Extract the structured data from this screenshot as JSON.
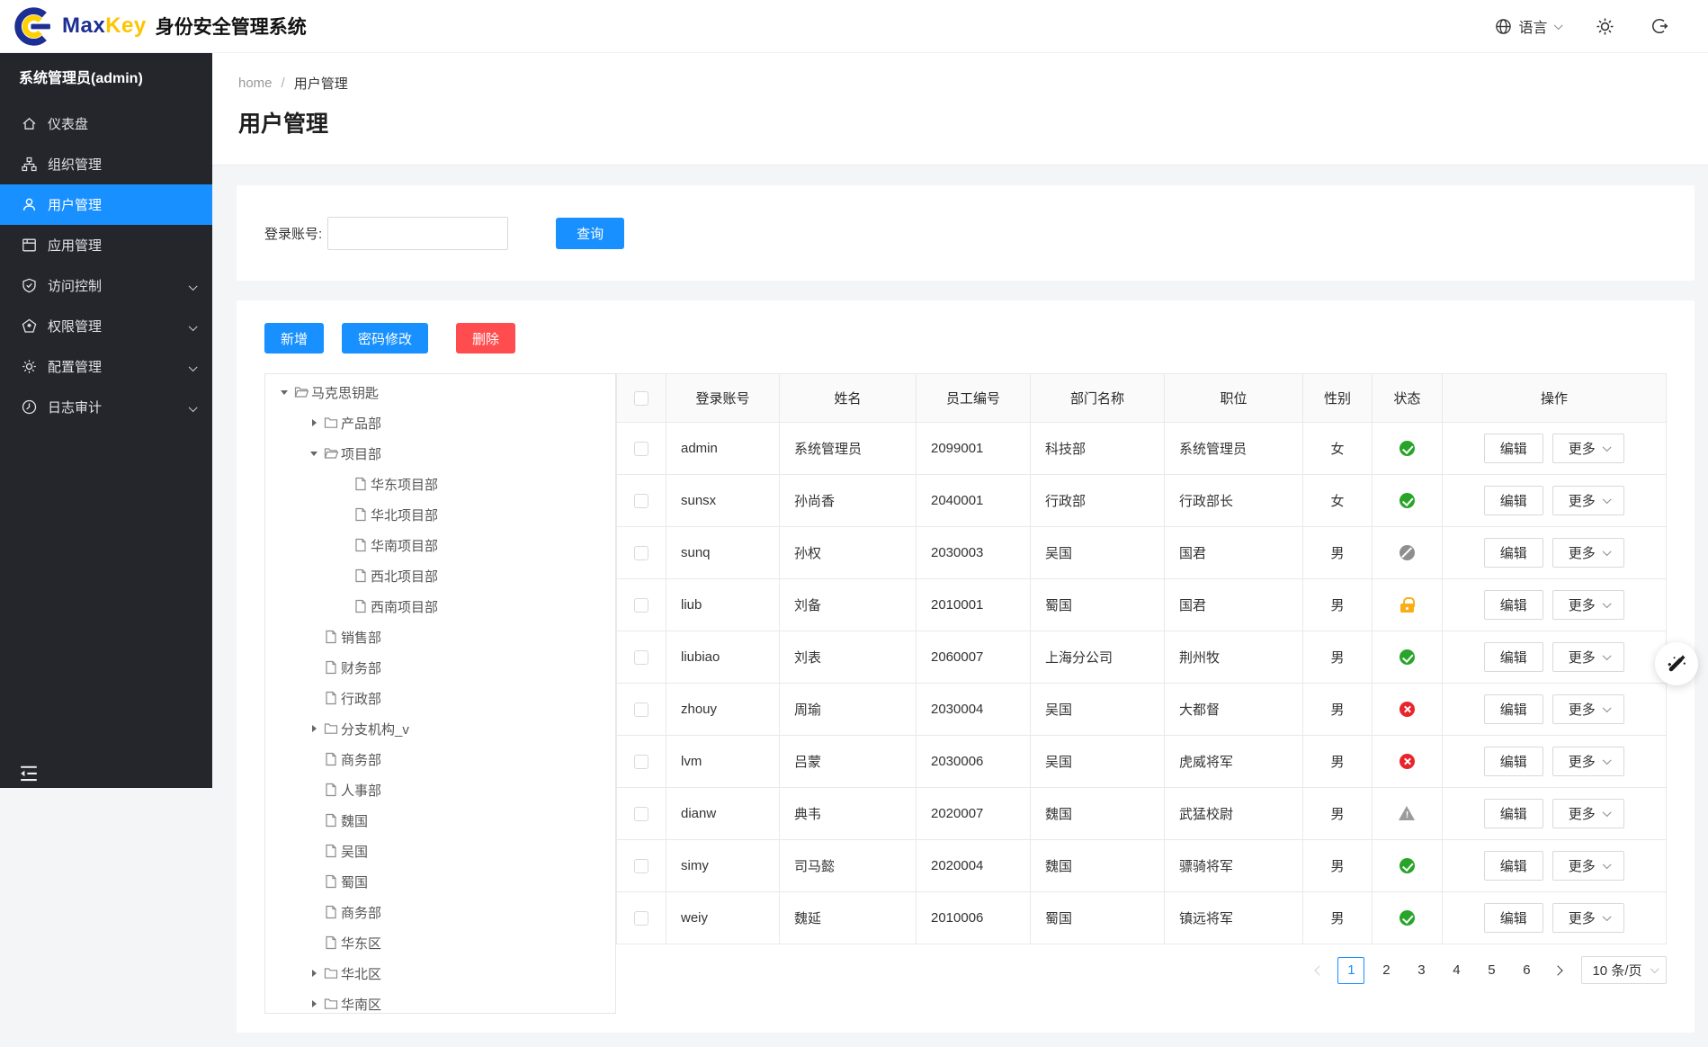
{
  "brand": {
    "max": "Max",
    "key": "Key",
    "app_title": "身份安全管理系统"
  },
  "topbar": {
    "language": "语言"
  },
  "sidebar": {
    "user_title": "系统管理员(admin)",
    "items": [
      {
        "id": "dashboard",
        "icon": "home",
        "label": "仪表盘",
        "active": false,
        "expandable": false
      },
      {
        "id": "org",
        "icon": "cluster",
        "label": "组织管理",
        "active": false,
        "expandable": false
      },
      {
        "id": "users",
        "icon": "user",
        "label": "用户管理",
        "active": true,
        "expandable": false
      },
      {
        "id": "apps",
        "icon": "appstore",
        "label": "应用管理",
        "active": false,
        "expandable": false
      },
      {
        "id": "access",
        "icon": "shield",
        "label": "访问控制",
        "active": false,
        "expandable": true
      },
      {
        "id": "permissions",
        "icon": "pentagon",
        "label": "权限管理",
        "active": false,
        "expandable": true
      },
      {
        "id": "config",
        "icon": "gear",
        "label": "配置管理",
        "active": false,
        "expandable": true
      },
      {
        "id": "audit",
        "icon": "clock",
        "label": "日志审计",
        "active": false,
        "expandable": true
      }
    ]
  },
  "breadcrumb": {
    "home": "home",
    "separator": "/",
    "current": "用户管理"
  },
  "page": {
    "title": "用户管理"
  },
  "search": {
    "label": "登录账号:",
    "input_value": "",
    "query": "查询"
  },
  "toolbar": {
    "add": "新增",
    "change_password": "密码修改",
    "remove": "删除"
  },
  "tree": {
    "nodes": [
      {
        "level": 0,
        "caret": "down",
        "icon": "folder-open",
        "label": "马克思钥匙"
      },
      {
        "level": 1,
        "caret": "right",
        "icon": "folder",
        "label": "产品部"
      },
      {
        "level": 1,
        "caret": "down",
        "icon": "folder-open",
        "label": "项目部"
      },
      {
        "level": 2,
        "caret": "none",
        "icon": "file",
        "label": "华东项目部"
      },
      {
        "level": 2,
        "caret": "none",
        "icon": "file",
        "label": "华北项目部"
      },
      {
        "level": 2,
        "caret": "none",
        "icon": "file",
        "label": "华南项目部"
      },
      {
        "level": 2,
        "caret": "none",
        "icon": "file",
        "label": "西北项目部"
      },
      {
        "level": 2,
        "caret": "none",
        "icon": "file",
        "label": "西南项目部"
      },
      {
        "level": 1,
        "caret": "none",
        "icon": "file",
        "label": "销售部"
      },
      {
        "level": 1,
        "caret": "none",
        "icon": "file",
        "label": "财务部"
      },
      {
        "level": 1,
        "caret": "none",
        "icon": "file",
        "label": "行政部"
      },
      {
        "level": 1,
        "caret": "right",
        "icon": "folder",
        "label": "分支机构_v"
      },
      {
        "level": 1,
        "caret": "none",
        "icon": "file",
        "label": "商务部"
      },
      {
        "level": 1,
        "caret": "none",
        "icon": "file",
        "label": "人事部"
      },
      {
        "level": 1,
        "caret": "none",
        "icon": "file",
        "label": "魏国"
      },
      {
        "level": 1,
        "caret": "none",
        "icon": "file",
        "label": "吴国"
      },
      {
        "level": 1,
        "caret": "none",
        "icon": "file",
        "label": "蜀国"
      },
      {
        "level": 1,
        "caret": "none",
        "icon": "file",
        "label": "商务部"
      },
      {
        "level": 1,
        "caret": "none",
        "icon": "file",
        "label": "华东区"
      },
      {
        "level": 1,
        "caret": "right",
        "icon": "folder",
        "label": "华北区"
      },
      {
        "level": 1,
        "caret": "right",
        "icon": "folder",
        "label": "华南区"
      }
    ]
  },
  "table": {
    "headers": [
      "登录账号",
      "姓名",
      "员工编号",
      "部门名称",
      "职位",
      "性别",
      "状态",
      "操作"
    ],
    "edit": "编辑",
    "more": "更多",
    "rows": [
      {
        "login": "admin",
        "name": "系统管理员",
        "employee_no": "2099001",
        "department": "科技部",
        "position": "系统管理员",
        "gender": "女",
        "status": "active"
      },
      {
        "login": "sunsx",
        "name": "孙尚香",
        "employee_no": "2040001",
        "department": "行政部",
        "position": "行政部长",
        "gender": "女",
        "status": "active"
      },
      {
        "login": "sunq",
        "name": "孙权",
        "employee_no": "2030003",
        "department": "吴国",
        "position": "国君",
        "gender": "男",
        "status": "disabled"
      },
      {
        "login": "liub",
        "name": "刘备",
        "employee_no": "2010001",
        "department": "蜀国",
        "position": "国君",
        "gender": "男",
        "status": "locked"
      },
      {
        "login": "liubiao",
        "name": "刘表",
        "employee_no": "2060007",
        "department": "上海分公司",
        "position": "荆州牧",
        "gender": "男",
        "status": "active"
      },
      {
        "login": "zhouy",
        "name": "周瑜",
        "employee_no": "2030004",
        "department": "吴国",
        "position": "大都督",
        "gender": "男",
        "status": "inactive"
      },
      {
        "login": "lvm",
        "name": "吕蒙",
        "employee_no": "2030006",
        "department": "吴国",
        "position": "虎威将军",
        "gender": "男",
        "status": "inactive"
      },
      {
        "login": "dianw",
        "name": "典韦",
        "employee_no": "2020007",
        "department": "魏国",
        "position": "武猛校尉",
        "gender": "男",
        "status": "warning"
      },
      {
        "login": "simy",
        "name": "司马懿",
        "employee_no": "2020004",
        "department": "魏国",
        "position": "骠骑将军",
        "gender": "男",
        "status": "active"
      },
      {
        "login": "weiy",
        "name": "魏延",
        "employee_no": "2010006",
        "department": "蜀国",
        "position": "镇远将军",
        "gender": "男",
        "status": "active"
      }
    ]
  },
  "pagination": {
    "pages": [
      "1",
      "2",
      "3",
      "4",
      "5",
      "6"
    ],
    "active_page": "1",
    "page_size": "10 条/页"
  },
  "colors": {
    "accent": "#1890ff",
    "danger": "#ff4d4f",
    "sidebar_bg": "#24262c",
    "status_active": "#28a428",
    "status_inactive": "#e8252c",
    "status_locked": "#faad14",
    "status_disabled": "#8f8f8f",
    "status_warning": "#9b9b9b"
  }
}
